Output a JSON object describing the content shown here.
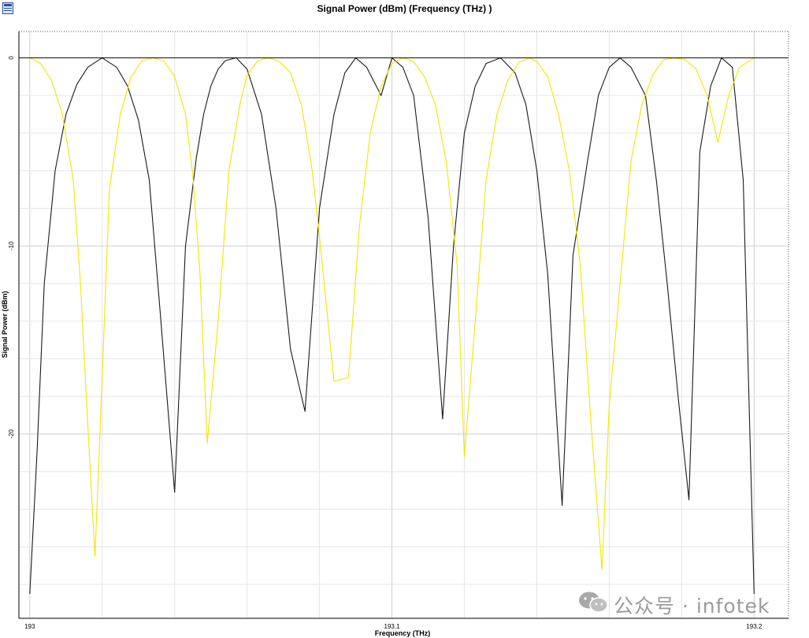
{
  "window": {
    "icon": "chart-window-icon"
  },
  "watermark": {
    "text": "公众号 · infotek",
    "icon": "wechat-icon"
  },
  "chart_data": {
    "type": "line",
    "title": "Signal Power (dBm) (Frequency (THz) )",
    "xlabel": "Frequency (THz)",
    "ylabel": "Signal Power (dBm)",
    "xlim": [
      192.997,
      193.2095
    ],
    "ylim": [
      -29.8,
      1.4
    ],
    "xticks": [
      193,
      193.1,
      193.2
    ],
    "xtick_labels": [
      "193",
      "193.1",
      "193.2"
    ],
    "yticks": [
      0,
      -10,
      -20
    ],
    "ytick_labels": [
      "0",
      "-10",
      "-20"
    ],
    "grid": true,
    "legend": "none",
    "colors": {
      "series_black": "#1a1a1a",
      "series_yellow": "#f2e600",
      "grid": "#dcdcdc",
      "zero_line": "#000000"
    },
    "series": [
      {
        "color": "#1a1a1a",
        "x": [
          193.0,
          193.002,
          193.004,
          193.007,
          193.01,
          193.013,
          193.016,
          193.02,
          193.024,
          193.027,
          193.03,
          193.033,
          193.036,
          193.04,
          193.043,
          193.046,
          193.048,
          193.05,
          193.052,
          193.054,
          193.057,
          193.06,
          193.064,
          193.068,
          193.072,
          193.076,
          193.08,
          193.084,
          193.087,
          193.09,
          193.093,
          193.097,
          193.1,
          193.103,
          193.106,
          193.11,
          193.114,
          193.117,
          193.12,
          193.123,
          193.126,
          193.13,
          193.134,
          193.137,
          193.14,
          193.143,
          193.147,
          193.15,
          193.154,
          193.157,
          193.16,
          193.163,
          193.166,
          193.17,
          193.173,
          193.176,
          193.179,
          193.182,
          193.185,
          193.188,
          193.191,
          193.194,
          193.197,
          193.2
        ],
        "y": [
          -28.5,
          -21.0,
          -12.0,
          -6.0,
          -3.0,
          -1.4,
          -0.5,
          0.0,
          -0.5,
          -1.5,
          -3.3,
          -6.5,
          -13.5,
          -23.1,
          -10.0,
          -5.3,
          -3.0,
          -1.5,
          -0.6,
          -0.15,
          0.0,
          -0.6,
          -3.0,
          -8.0,
          -15.5,
          -18.8,
          -8.0,
          -3.0,
          -0.8,
          0.0,
          -0.5,
          -2.0,
          0.0,
          -0.5,
          -2.0,
          -8.5,
          -19.2,
          -10.0,
          -4.0,
          -1.5,
          -0.3,
          0.0,
          -0.8,
          -2.5,
          -6.0,
          -11.5,
          -23.8,
          -10.5,
          -5.5,
          -2.0,
          -0.5,
          0.0,
          -0.5,
          -2.0,
          -6.5,
          -12.0,
          -18.0,
          -23.5,
          -5.0,
          -1.5,
          0.0,
          -0.5,
          -6.5,
          -28.5
        ]
      },
      {
        "color": "#f2e600",
        "x": [
          193.0,
          193.003,
          193.006,
          193.009,
          193.012,
          193.014,
          193.016,
          193.018,
          193.02,
          193.022,
          193.025,
          193.028,
          193.031,
          193.034,
          193.037,
          193.04,
          193.043,
          193.045,
          193.047,
          193.049,
          193.052,
          193.055,
          193.058,
          193.06,
          193.063,
          193.066,
          193.069,
          193.072,
          193.075,
          193.078,
          193.08,
          193.084,
          193.088,
          193.091,
          193.094,
          193.097,
          193.1,
          193.103,
          193.106,
          193.109,
          193.112,
          193.115,
          193.118,
          193.12,
          193.123,
          193.126,
          193.129,
          193.132,
          193.135,
          193.138,
          193.14,
          193.143,
          193.146,
          193.149,
          193.152,
          193.155,
          193.158,
          193.16,
          193.163,
          193.166,
          193.169,
          193.172,
          193.175,
          193.178,
          193.181,
          193.184,
          193.187,
          193.19,
          193.193,
          193.196,
          193.2
        ],
        "y": [
          0.0,
          -0.3,
          -1.2,
          -3.0,
          -6.5,
          -12.0,
          -19.5,
          -26.5,
          -17.0,
          -7.0,
          -3.0,
          -1.0,
          -0.15,
          0.0,
          -0.15,
          -1.0,
          -3.0,
          -6.2,
          -11.5,
          -20.5,
          -14.0,
          -6.0,
          -2.5,
          -0.9,
          -0.15,
          0.0,
          -0.2,
          -0.8,
          -2.5,
          -6.0,
          -9.5,
          -17.2,
          -17.0,
          -9.0,
          -4.0,
          -1.5,
          -0.3,
          0.0,
          -0.2,
          -1.0,
          -2.5,
          -5.5,
          -11.0,
          -21.2,
          -14.0,
          -6.5,
          -3.0,
          -1.2,
          -0.25,
          0.0,
          -0.2,
          -1.0,
          -3.0,
          -6.0,
          -11.0,
          -19.5,
          -27.2,
          -18.5,
          -12.0,
          -5.5,
          -2.5,
          -0.9,
          -0.1,
          0.0,
          -0.1,
          -0.6,
          -2.0,
          -4.5,
          -2.0,
          -0.5,
          0.0
        ]
      }
    ]
  }
}
